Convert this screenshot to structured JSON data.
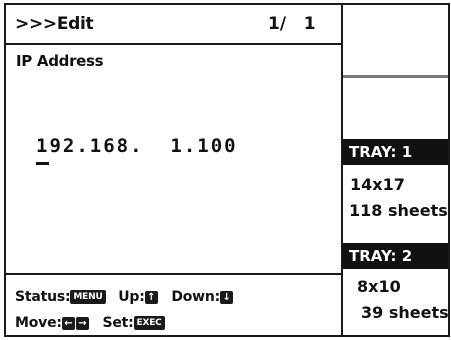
{
  "header": {
    "title": ">>>Edit",
    "page_counter": "1/   1"
  },
  "field": {
    "label": "IP Address",
    "value": "192.168.  1.100"
  },
  "help": {
    "status_label": "Status:",
    "status_key": "MENU",
    "up_label": "Up:",
    "up_key": "↑",
    "down_label": "Down:",
    "down_key": "↓",
    "move_label": "Move:",
    "move_key_left": "←",
    "move_key_right": "→",
    "set_label": "Set:",
    "set_key": "EXEC"
  },
  "trays": [
    {
      "name": "TRAY: 1",
      "size": "14x17",
      "sheets": "118 sheets"
    },
    {
      "name": "TRAY: 2",
      "size": "8x10",
      "sheets": "39 sheets"
    }
  ],
  "colors": {
    "foreground": "#111111",
    "background": "#ffffff",
    "divider_gray": "#7a7a7a"
  }
}
